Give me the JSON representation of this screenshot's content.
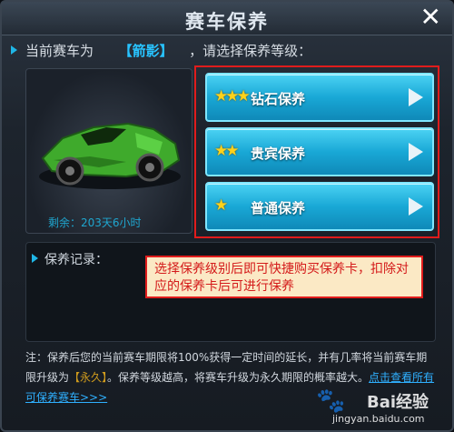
{
  "window": {
    "title": "赛车保养",
    "close_glyph": "✕"
  },
  "header": {
    "prefix": "当前赛车为",
    "car_name": "【箭影】",
    "suffix": "，请选择保养等级："
  },
  "car": {
    "remaining_time": "剩余：203天6小时",
    "color": "#3faa2c"
  },
  "options": [
    {
      "label": "钻石保养",
      "stars": "★★★"
    },
    {
      "label": "贵宾保养",
      "stars": "★★"
    },
    {
      "label": "普通保养",
      "stars": "★"
    }
  ],
  "record": {
    "label": "保养记录："
  },
  "tooltip": {
    "text": "选择保养级别后即可快捷购买保养卡，扣除对应的保养卡后可进行保养"
  },
  "note": {
    "part1": "注：保养后您的当前赛车期限将100%获得一定时间的延长，并有几率将当前赛车期限升级为",
    "highlight": "【永久】",
    "part2": "。保养等级越高，将赛车升级为永久期限的概率越大。",
    "link": "点击查看所有可保养赛车>>>"
  },
  "watermark": {
    "brand": "Bai经验",
    "url": "jingyan.baidu.com"
  },
  "colors": {
    "accent": "#1fb6e6",
    "button": "#19a8d6",
    "highlight_border": "#e01c1c",
    "tooltip_bg": "#fbe9c5"
  }
}
